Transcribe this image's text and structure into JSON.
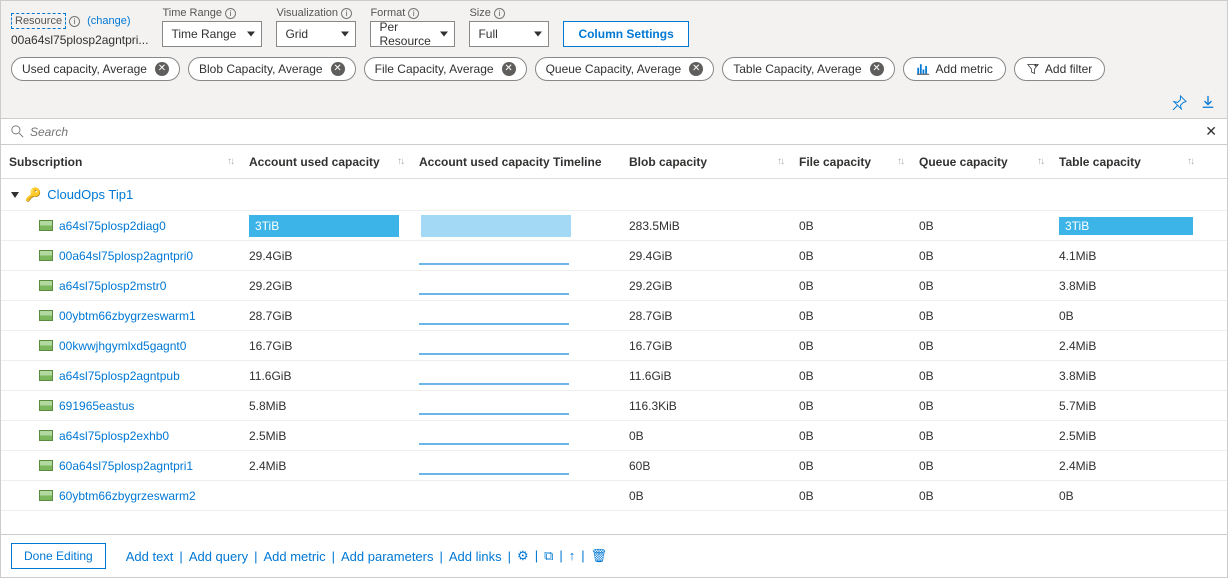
{
  "toolbar": {
    "resource_label": "Resource",
    "change_label": "(change)",
    "resource_value": "00a64sl75plosp2agntpri...",
    "time_range_label": "Time Range",
    "time_range_value": "Time Range",
    "visualization_label": "Visualization",
    "visualization_value": "Grid",
    "format_label": "Format",
    "format_value": "Per Resource",
    "size_label": "Size",
    "size_value": "Full",
    "column_settings": "Column Settings"
  },
  "metrics": [
    "Used capacity, Average",
    "Blob Capacity, Average",
    "File Capacity, Average",
    "Queue Capacity, Average",
    "Table Capacity, Average"
  ],
  "actions": {
    "add_metric": "Add metric",
    "add_filter": "Add filter"
  },
  "search": {
    "placeholder": "Search"
  },
  "columns": {
    "subscription": "Subscription",
    "used": "Account used capacity",
    "timeline": "Account used capacity Timeline",
    "blob": "Blob capacity",
    "file": "File capacity",
    "queue": "Queue capacity",
    "table": "Table capacity"
  },
  "group_name": "CloudOps Tip1",
  "rows": [
    {
      "name": "a64sl75plosp2diag0",
      "used": "3TiB",
      "blob": "283.5MiB",
      "file": "0B",
      "queue": "0B",
      "table": "3TiB",
      "highlight": true
    },
    {
      "name": "00a64sl75plosp2agntpri0",
      "used": "29.4GiB",
      "blob": "29.4GiB",
      "file": "0B",
      "queue": "0B",
      "table": "4.1MiB"
    },
    {
      "name": "a64sl75plosp2mstr0",
      "used": "29.2GiB",
      "blob": "29.2GiB",
      "file": "0B",
      "queue": "0B",
      "table": "3.8MiB"
    },
    {
      "name": "00ybtm66zbygrzeswarm1",
      "used": "28.7GiB",
      "blob": "28.7GiB",
      "file": "0B",
      "queue": "0B",
      "table": "0B"
    },
    {
      "name": "00kwwjhgymlxd5gagnt0",
      "used": "16.7GiB",
      "blob": "16.7GiB",
      "file": "0B",
      "queue": "0B",
      "table": "2.4MiB"
    },
    {
      "name": "a64sl75plosp2agntpub",
      "used": "11.6GiB",
      "blob": "11.6GiB",
      "file": "0B",
      "queue": "0B",
      "table": "3.8MiB"
    },
    {
      "name": "691965eastus",
      "used": "5.8MiB",
      "blob": "116.3KiB",
      "file": "0B",
      "queue": "0B",
      "table": "5.7MiB"
    },
    {
      "name": "a64sl75plosp2exhb0",
      "used": "2.5MiB",
      "blob": "0B",
      "file": "0B",
      "queue": "0B",
      "table": "2.5MiB"
    },
    {
      "name": "60a64sl75plosp2agntpri1",
      "used": "2.4MiB",
      "blob": "60B",
      "file": "0B",
      "queue": "0B",
      "table": "2.4MiB"
    },
    {
      "name": "60ybtm66zbygrzeswarm2",
      "used": "",
      "blob": "0B",
      "file": "0B",
      "queue": "0B",
      "table": "0B"
    }
  ],
  "footer": {
    "done": "Done Editing",
    "add_text": "Add text",
    "add_query": "Add query",
    "add_metric": "Add metric",
    "add_parameters": "Add parameters",
    "add_links": "Add links"
  }
}
